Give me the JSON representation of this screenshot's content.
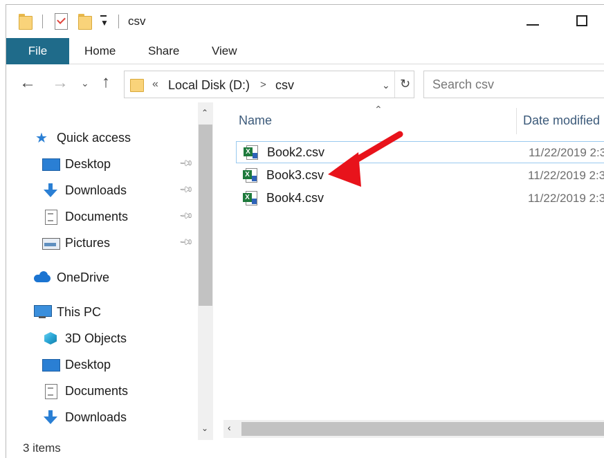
{
  "window": {
    "title": "csv"
  },
  "ribbon": {
    "tabs": [
      "File",
      "Home",
      "Share",
      "View"
    ]
  },
  "address": {
    "overflow": "«",
    "segments": [
      "Local Disk (D:)",
      "csv"
    ],
    "separator": ">"
  },
  "search": {
    "placeholder": "Search csv"
  },
  "nav": {
    "quick_access": "Quick access",
    "quick_items": [
      {
        "label": "Desktop",
        "icon": "desktop-icon",
        "pinned": true
      },
      {
        "label": "Downloads",
        "icon": "downloads-icon",
        "pinned": true
      },
      {
        "label": "Documents",
        "icon": "documents-icon",
        "pinned": true
      },
      {
        "label": "Pictures",
        "icon": "pictures-icon",
        "pinned": true
      }
    ],
    "onedrive": "OneDrive",
    "this_pc": "This PC",
    "pc_items": [
      {
        "label": "3D Objects",
        "icon": "3d-objects-icon"
      },
      {
        "label": "Desktop",
        "icon": "desktop-icon"
      },
      {
        "label": "Documents",
        "icon": "documents-icon"
      },
      {
        "label": "Downloads",
        "icon": "downloads-icon"
      }
    ]
  },
  "columns": {
    "name": "Name",
    "date": "Date modified"
  },
  "files": [
    {
      "name": "Book2.csv",
      "date": "11/22/2019 2:3"
    },
    {
      "name": "Book3.csv",
      "date": "11/22/2019 2:3"
    },
    {
      "name": "Book4.csv",
      "date": "11/22/2019 2:3"
    }
  ],
  "status": {
    "items": "3 items"
  },
  "colors": {
    "file_tab": "#1f6b8a",
    "arrow": "#e8131b",
    "selection_border": "#99c9ef"
  }
}
